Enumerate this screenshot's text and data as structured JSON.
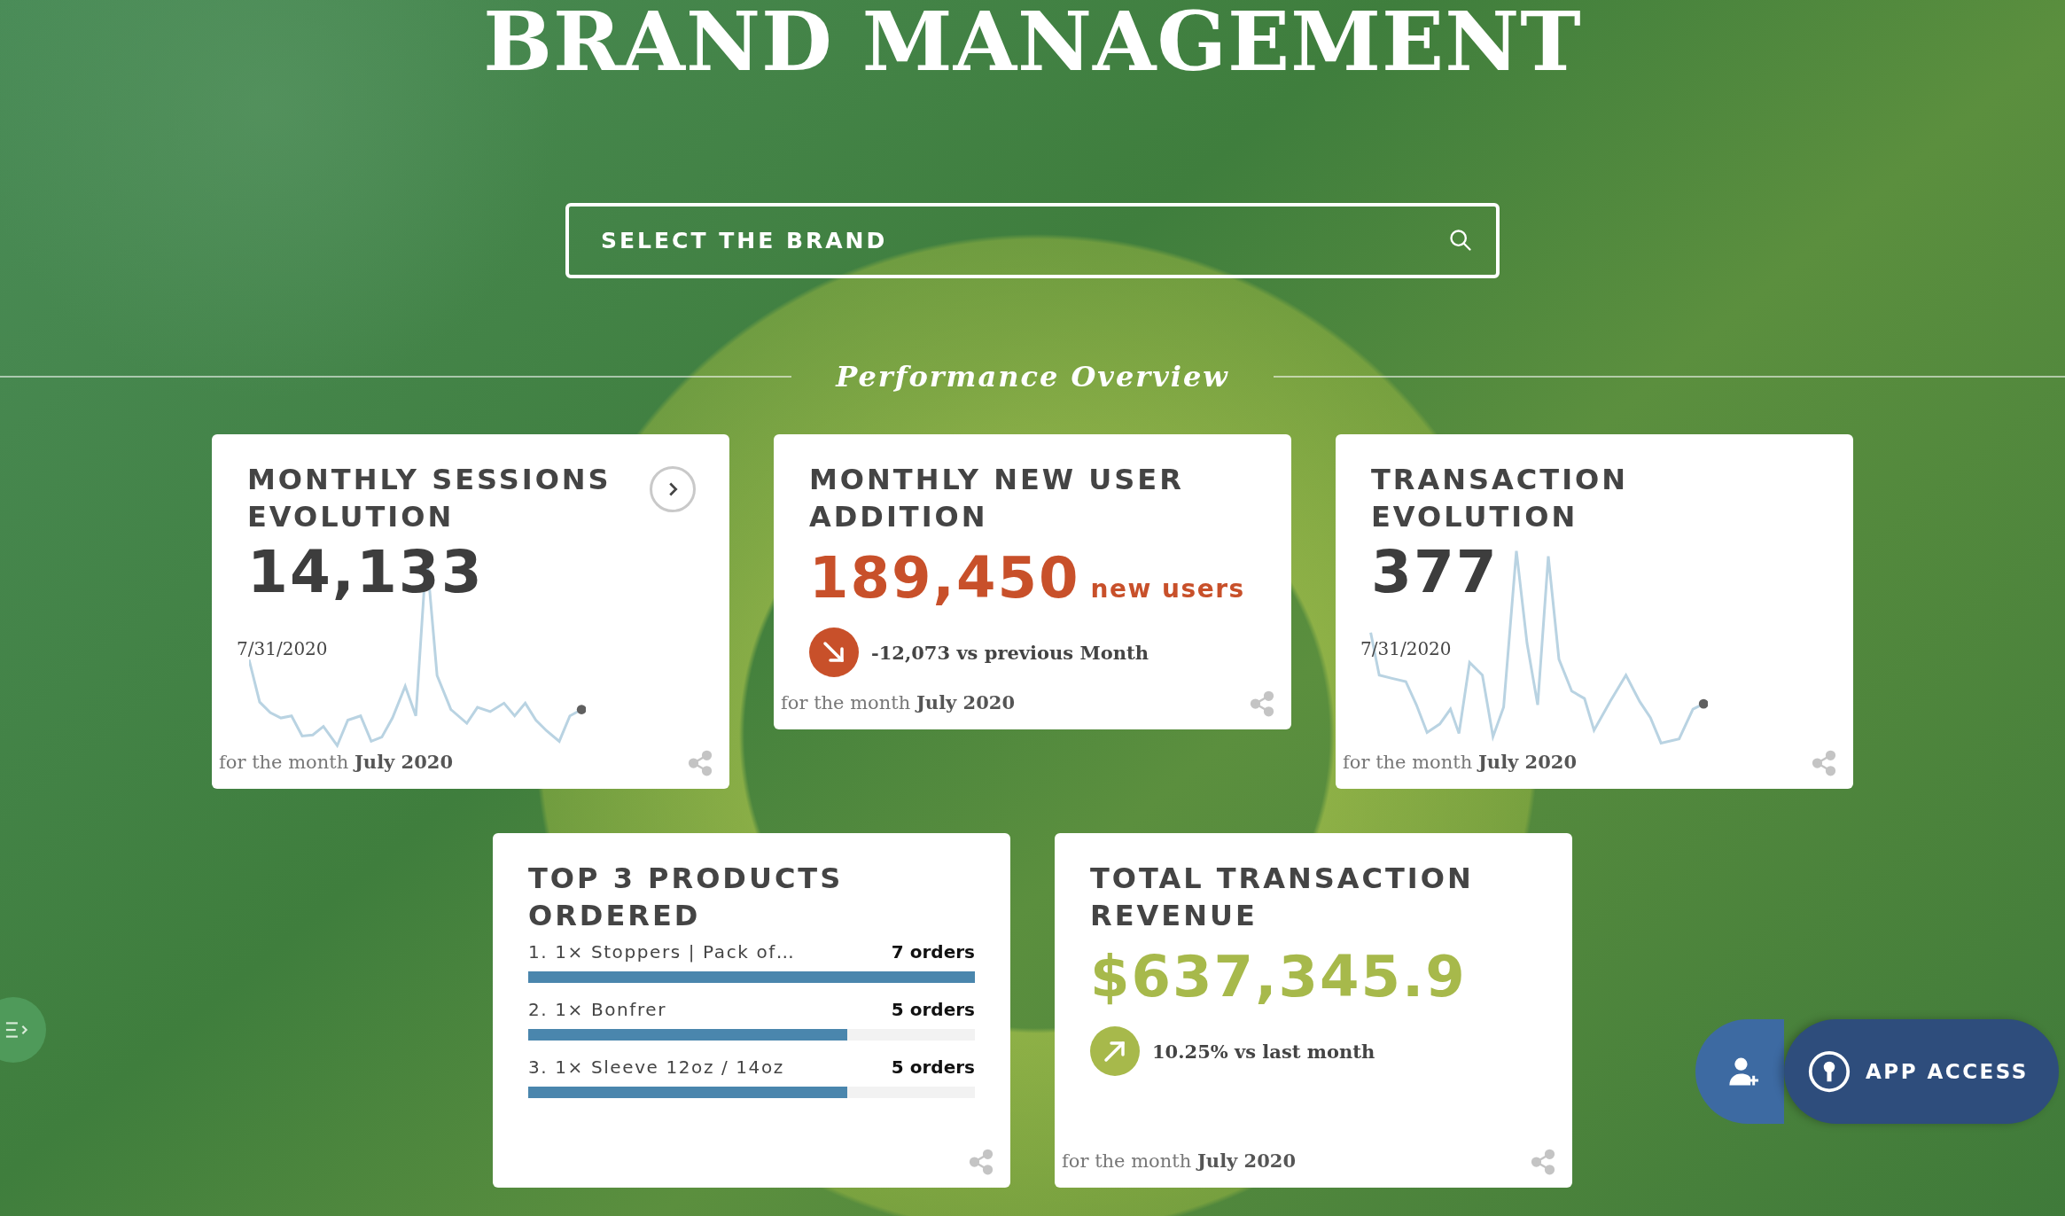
{
  "title": "BRAND MANAGEMENT",
  "search": {
    "placeholder": "SELECT THE BRAND"
  },
  "section_title": "Performance Overview",
  "rows": [
    {
      "cards": [
        {
          "kind": "sparkline",
          "title": "MONTHLY SESSIONS EVOLUTION",
          "value": "14,133",
          "date": "7/31/2020",
          "footer": "for the month **July 2020**",
          "has_next": true
        },
        {
          "kind": "delta",
          "title": "MONTHLY NEW USER ADDITION",
          "value": "189,450",
          "unit": "new users",
          "rising": false,
          "delta": "-12,073 vs previous Month",
          "footer": "for the month **July 2020**"
        },
        {
          "kind": "sparkline",
          "title": "TRANSACTION EVOLUTION",
          "value": "377",
          "date": "7/31/2020",
          "footer": "for the month **July 2020**",
          "has_next": false
        }
      ]
    },
    {
      "cards": [
        {
          "kind": "bars",
          "title": "TOP 3 PRODUCTS ORDERED",
          "items": [
            {
              "label": "1. 1× Stoppers | Pack of…",
              "count": "7 orders",
              "level": 1
            },
            {
              "label": "2. 1× Bonfrer",
              "count": "5 orders",
              "level": 0.714
            },
            {
              "label": "3. 1× Sleeve 12oz / 14oz",
              "count": "5 orders",
              "level": 0.714
            }
          ]
        },
        {
          "kind": "delta",
          "title": "TOTAL TRANSACTION REVENUE",
          "value": "$637,345.9",
          "rising": true,
          "delta": "10.25% vs last month",
          "footer": "for the month **July 2020**"
        }
      ]
    }
  ],
  "app_access": {
    "label": "APP ACCESS"
  }
}
